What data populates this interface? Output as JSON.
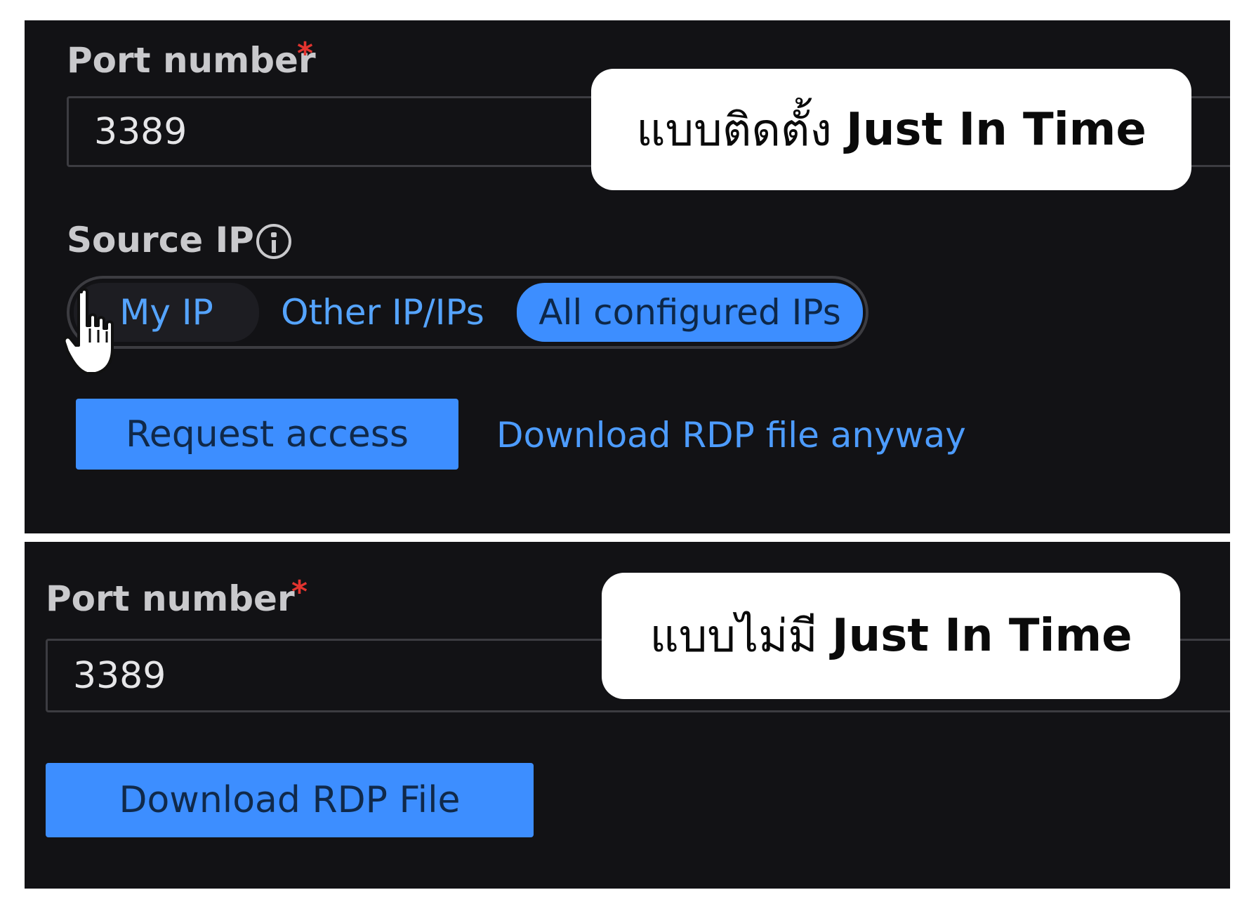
{
  "top_panel": {
    "port_label": "Port number",
    "required_mark": "*",
    "port_value": "3389",
    "callout": {
      "thai": "แบบติดตั้ง",
      "english": "Just In Time"
    },
    "source_ip_label": "Source IP",
    "source_ip_options": [
      "My IP",
      "Other IP/IPs",
      "All configured IPs"
    ],
    "selected_option": "All configured IPs",
    "request_access_label": "Request access",
    "download_anyway_label": "Download RDP file anyway"
  },
  "bottom_panel": {
    "port_label": "Port number",
    "required_mark": "*",
    "port_value": "3389",
    "callout": {
      "thai": "แบบไม่มี",
      "english": "Just In Time"
    },
    "download_button_label": "Download RDP File"
  },
  "icons": {
    "info": "info-icon",
    "cursor": "hand-pointer-icon"
  },
  "colors": {
    "panel_bg": "#121215",
    "accent": "#3d8eff",
    "link": "#4d9cff",
    "required": "#e3342f",
    "label_text": "#c9c9cc",
    "callout_bg": "#ffffff"
  }
}
